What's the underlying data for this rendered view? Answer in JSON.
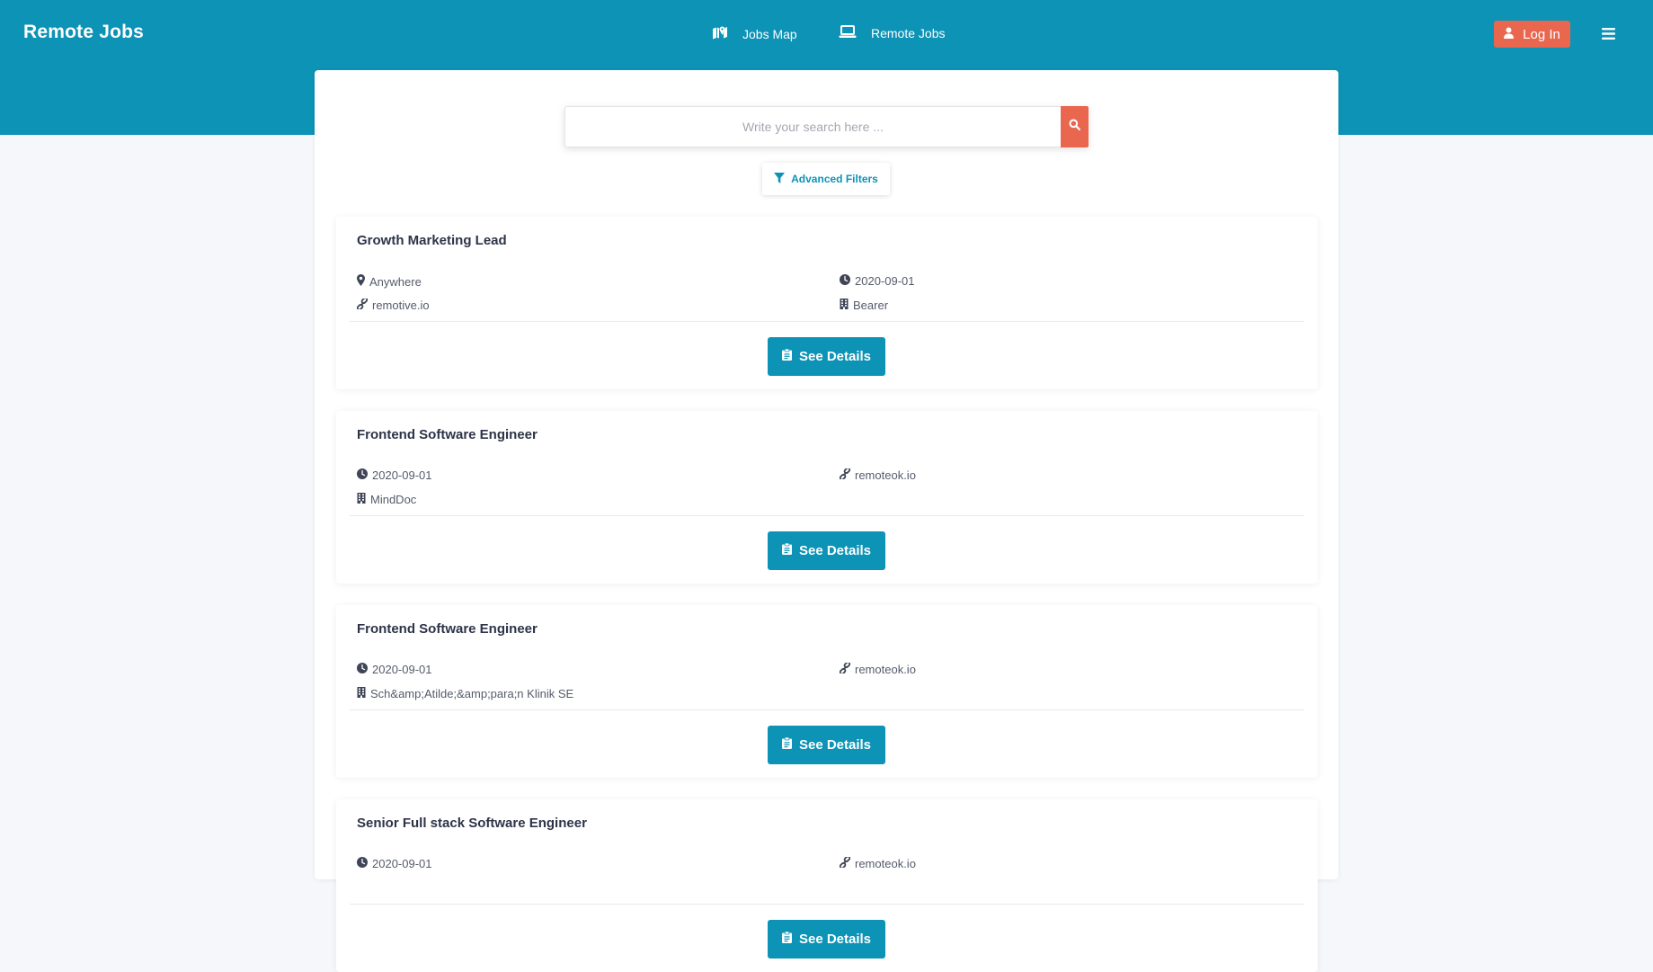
{
  "header": {
    "brand": "Remote Jobs",
    "nav": [
      {
        "label": "Jobs Map",
        "icon": "map-icon"
      },
      {
        "label": "Remote Jobs",
        "icon": "laptop-icon"
      }
    ],
    "login_label": "Log In",
    "menu_icon": "hamburger-menu-icon"
  },
  "search": {
    "placeholder": "Write your search here ...",
    "value": "",
    "filters_label": "Advanced Filters"
  },
  "colors": {
    "primary": "#0c93b6",
    "accent": "#e8674e",
    "background": "#f5f7fa"
  },
  "jobs": [
    {
      "title": "Growth Marketing Lead",
      "left_meta": [
        {
          "icon": "location-pin-icon",
          "text": "Anywhere"
        },
        {
          "icon": "link-icon",
          "text": "remotive.io"
        }
      ],
      "right_meta": [
        {
          "icon": "clock-icon",
          "text": "2020-09-01"
        },
        {
          "icon": "building-icon",
          "text": "Bearer"
        }
      ],
      "button_label": "See Details"
    },
    {
      "title": "Frontend Software Engineer",
      "left_meta": [
        {
          "icon": "clock-icon",
          "text": "2020-09-01"
        },
        {
          "icon": "building-icon",
          "text": "MindDoc"
        }
      ],
      "right_meta": [
        {
          "icon": "link-icon",
          "text": "remoteok.io"
        }
      ],
      "button_label": "See Details"
    },
    {
      "title": "Frontend Software Engineer",
      "left_meta": [
        {
          "icon": "clock-icon",
          "text": "2020-09-01"
        },
        {
          "icon": "building-icon",
          "text": "Sch&amp;Atilde;&amp;para;n Klinik SE"
        }
      ],
      "right_meta": [
        {
          "icon": "link-icon",
          "text": "remoteok.io"
        }
      ],
      "button_label": "See Details"
    },
    {
      "title": "Senior Full stack Software Engineer",
      "left_meta": [
        {
          "icon": "clock-icon",
          "text": "2020-09-01"
        }
      ],
      "right_meta": [
        {
          "icon": "link-icon",
          "text": "remoteok.io"
        }
      ],
      "button_label": "See Details"
    }
  ]
}
